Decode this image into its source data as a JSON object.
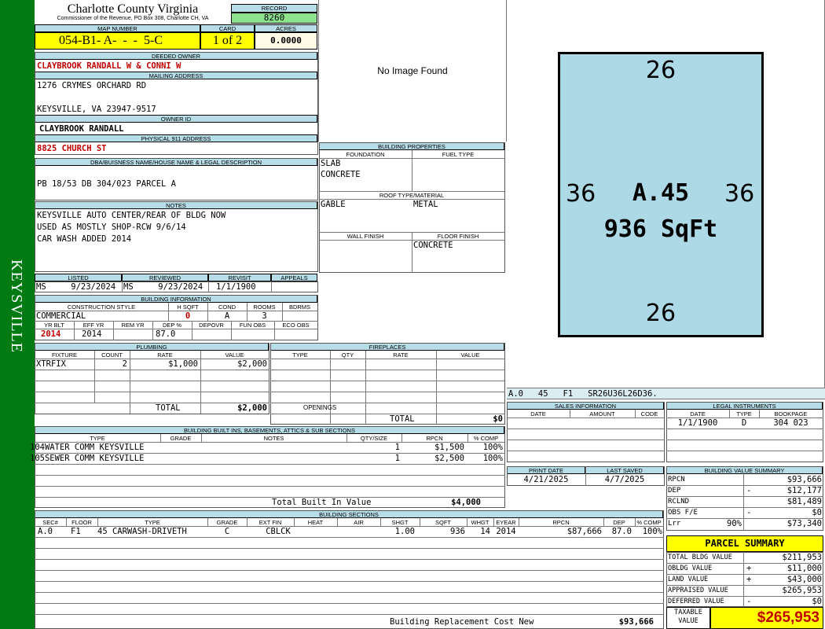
{
  "side_label": "KEYSVILLE",
  "header": {
    "county": "Charlotte County Virginia",
    "office": "Commissioner of the Revenue, PO Box 308, Charlotte CH, VA",
    "record_label": "RECORD",
    "record": "8260"
  },
  "parcel": {
    "map_label": "MAP NUMBER",
    "map": "054-B1- A-  -  -  5-C",
    "card_label": "CARD",
    "card": "1 of 2",
    "acres_label": "ACRES",
    "acres": "0.0000"
  },
  "owner": {
    "deeded_label": "DEEDED OWNER",
    "deeded": "CLAYBROOK RANDALL W & CONNI W",
    "mailing_label": "MAILING ADDRESS",
    "mail1": "1276 CRYMES ORCHARD RD",
    "mail2": "KEYSVILLE, VA 23947-9517",
    "owner_id_label": "OWNER ID",
    "owner_id": "CLAYBROOK RANDALL",
    "physical_label": "PHYSICAL 911 ADDRESS",
    "physical": "8825 CHURCH ST"
  },
  "dba": {
    "label": "DBA/BUISNESS NAME/HOUSE NAME & LEGAL DESCRIPTION",
    "text": "PB 18/53 DB 304/023 PARCEL A"
  },
  "notes": {
    "label": "NOTES",
    "lines": [
      "KEYSVILLE AUTO CENTER/REAR OF BLDG NOW",
      "USED AS MOSTLY SHOP-RCW 9/6/14",
      "CAR WASH ADDED 2014"
    ]
  },
  "listing": {
    "listed_label": "LISTED",
    "reviewed_label": "REVIEWED",
    "revisit_label": "REVISIT",
    "appeals_label": "APPEALS",
    "listed": "MS     9/23/2024",
    "reviewed": "MS     9/23/2024",
    "revisit": "1/1/1900",
    "appeals": ""
  },
  "bldg_info": {
    "label": "BUILDING INFORMATION",
    "cs_label": "CONSTRUCTION STYLE",
    "hsqft_label": "H SQFT",
    "cond_label": "COND",
    "rooms_label": "ROOMS",
    "bdrms_label": "BDRMS",
    "cs": "COMMERCIAL",
    "hsqft": "0",
    "cond": "A",
    "rooms": "3",
    "bdrms": "",
    "yrblt_label": "YR BLT",
    "effyr_label": "EFF YR",
    "remyr_label": "REM YR",
    "dep_label": "DEP %",
    "depovr_label": "DEPOVR",
    "funobs_label": "FUN OBS",
    "ecoobs_label": "ECO OBS",
    "yrblt": "2014",
    "effyr": "2014",
    "remyr": "",
    "dep": "87.0"
  },
  "photo": {
    "text": "No Image Found"
  },
  "props": {
    "label": "BUILDING PROPERTIES",
    "foundation_label": "FOUNDATION",
    "fuel_label": "FUEL TYPE",
    "foundation1": "SLAB",
    "foundation2": "CONCRETE",
    "roof_label": "ROOF TYPE/MATERIAL",
    "roof_type": "GABLE",
    "roof_mat": "METAL",
    "wall_label": "WALL FINISH",
    "floor_label": "FLOOR FINISH",
    "floor": "CONCRETE"
  },
  "sketch": {
    "top": "26",
    "bottom": "26",
    "left": "36",
    "right": "36",
    "center": "A.45",
    "area": "936 SqFt",
    "code": "A.0   45   F1   SR26U36L26D36."
  },
  "plumbing": {
    "label": "PLUMBING",
    "headers": [
      "FIXTURE",
      "COUNT",
      "RATE",
      "VALUE"
    ],
    "rows": [
      [
        "XTRFIX",
        "2",
        "$1,000",
        "$2,000"
      ]
    ],
    "total_label": "TOTAL",
    "total": "$2,000"
  },
  "fireplaces": {
    "label": "FIREPLACES",
    "headers": [
      "TYPE",
      "QTY",
      "RATE",
      "VALUE"
    ],
    "openings_label": "OPENINGS",
    "total_label": "TOTAL",
    "total": "$0"
  },
  "sales": {
    "label": "SALES INFORMATION",
    "headers": [
      "DATE",
      "AMOUNT",
      "CODE"
    ]
  },
  "legal": {
    "label": "LEGAL INSTRUMENTS",
    "headers": [
      "DATE",
      "TYPE",
      "BOOKPAGE"
    ],
    "rows": [
      [
        "1/1/1900",
        "D",
        "304 023"
      ]
    ]
  },
  "builtins": {
    "label": "BUILDING BUILT INS, BASEMENTS, ATTICS & SUB SECTIONS",
    "headers": [
      "TYPE",
      "GRADE",
      "NOTES",
      "QTY/SIZE",
      "RPCN",
      "% COMP"
    ],
    "rows": [
      [
        "104WATER COMM KEYSVILLE",
        "",
        "",
        "1",
        "$1,500",
        "100%"
      ],
      [
        "105SEWER COMM KEYSVILLE",
        "",
        "",
        "1",
        "$2,500",
        "100%"
      ]
    ],
    "total_label": "Total Built In Value",
    "total": "$4,000"
  },
  "dates": {
    "print_label": "PRINT DATE",
    "saved_label": "LAST SAVED",
    "print": "4/21/2025",
    "saved": "4/7/2025"
  },
  "value_summary": {
    "label": "BUILDING VALUE SUMMARY",
    "rows": [
      [
        "RPCN",
        "",
        "$93,666"
      ],
      [
        "DEP",
        "-",
        "$12,177"
      ],
      [
        "RCLND",
        "",
        "$81,489"
      ],
      [
        "OBS F/E",
        "-",
        "$0"
      ],
      [
        "Lrr",
        "90%",
        "$73,340"
      ]
    ]
  },
  "sections": {
    "label": "BUILDING SECTIONS",
    "headers": [
      "SEC#",
      "FLOOR",
      "TYPE",
      "GRADE",
      "EXT FIN",
      "HEAT",
      "AIR",
      "SHGT",
      "SQFT",
      "WHGT",
      "EYEAR",
      "RPCN",
      "DEP",
      "% COMP"
    ],
    "rows": [
      [
        "A.0",
        "F1",
        "45 CARWASH-DRIVETH",
        "C",
        "CBLCK",
        "",
        "",
        "1.00",
        "936",
        "14",
        "2014",
        "$87,666",
        "87.0",
        "100%"
      ]
    ],
    "total_label": "Building Replacement Cost New",
    "total": "$93,666"
  },
  "summary": {
    "title": "PARCEL SUMMARY",
    "rows": [
      [
        "TOTAL BLDG VALUE",
        "",
        "$211,953"
      ],
      [
        "OBLDG VALUE",
        "+",
        "$11,000"
      ],
      [
        "LAND VALUE",
        "+",
        "$43,000"
      ],
      [
        "APPRAISED VALUE",
        "",
        "$265,953"
      ],
      [
        "DEFERRED VALUE",
        "-",
        "$0"
      ]
    ],
    "taxable_label1": "TAXABLE",
    "taxable_label2": "VALUE",
    "taxable": "$265,953"
  },
  "colors": {
    "green": "#007a12",
    "header_blue": "#b7dde8",
    "record_green": "#8ee28e",
    "yellow": "#ffff00",
    "sketch_fill": "#add8e6"
  }
}
